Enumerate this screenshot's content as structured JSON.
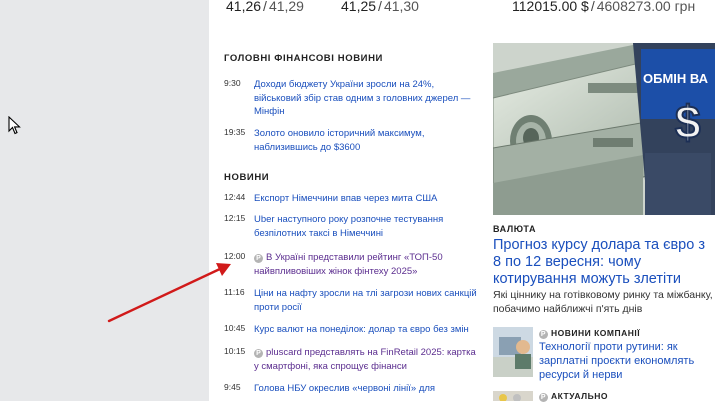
{
  "rates": [
    {
      "buy": "41,26",
      "sell": "41,29"
    },
    {
      "buy": "41,25",
      "sell": "41,30"
    },
    {
      "buy": "112015.00 $",
      "sell": "4608273.00 грн"
    }
  ],
  "main_news": {
    "title": "ГОЛОВНІ ФІНАНСОВІ НОВИНИ",
    "items": [
      {
        "time": "9:30",
        "text": "Доходи бюджету України зросли на 24%, військовий збір став одним з головних джерел — Мінфін"
      },
      {
        "time": "19:35",
        "text": "Золото оновило історичний максимум, наблизившись до $3600"
      }
    ]
  },
  "news": {
    "title": "НОВИНИ",
    "items": [
      {
        "time": "12:44",
        "text": "Експорт Німеччини впав через мита США",
        "badge": ""
      },
      {
        "time": "12:15",
        "text": "Uber наступного року розпочне тестування безпілотних таксі в Німеччині",
        "badge": ""
      },
      {
        "time": "12:00",
        "text": "В Україні представили рейтинг «ТОП-50 найвпливовіших жінок фінтеху 2025»",
        "badge": "P"
      },
      {
        "time": "11:16",
        "text": "Ціни на нафту зросли на тлі загрози нових санкцій проти росії",
        "badge": ""
      },
      {
        "time": "10:45",
        "text": "Курс валют на понеділок: долар та євро без змін",
        "badge": ""
      },
      {
        "time": "10:15",
        "text": "pluscard представлять на FinRetail 2025: картка у смартфоні, яка спрощує фінанси",
        "badge": "P"
      },
      {
        "time": "9:45",
        "text": "Голова НБУ окреслив «червоні лінії» для",
        "badge": ""
      }
    ]
  },
  "featured": {
    "photo_sign": "ОБМІН ВА",
    "category": "ВАЛЮТА",
    "headline": "Прогноз курсу долара та євро з 8 по 12 вересня: чому котирування можуть злетіти",
    "lead": "Які ціннику на готівковому ринку та міжбанку, побачимо найближчі п'ять днів"
  },
  "sub_items": [
    {
      "badge": "P",
      "category": "НОВИНИ КОМПАНІЇ",
      "title": "Технології проти рутини: як зарплатні проєкти економлять ресурси й нерви"
    },
    {
      "badge": "P",
      "category": "АКТУАЛЬНО",
      "title": ""
    }
  ],
  "colors": {
    "link": "#1a4fbd",
    "visited": "#5b2d8f",
    "gutter": "#e7e8ea",
    "arrow": "#d11a1a"
  }
}
